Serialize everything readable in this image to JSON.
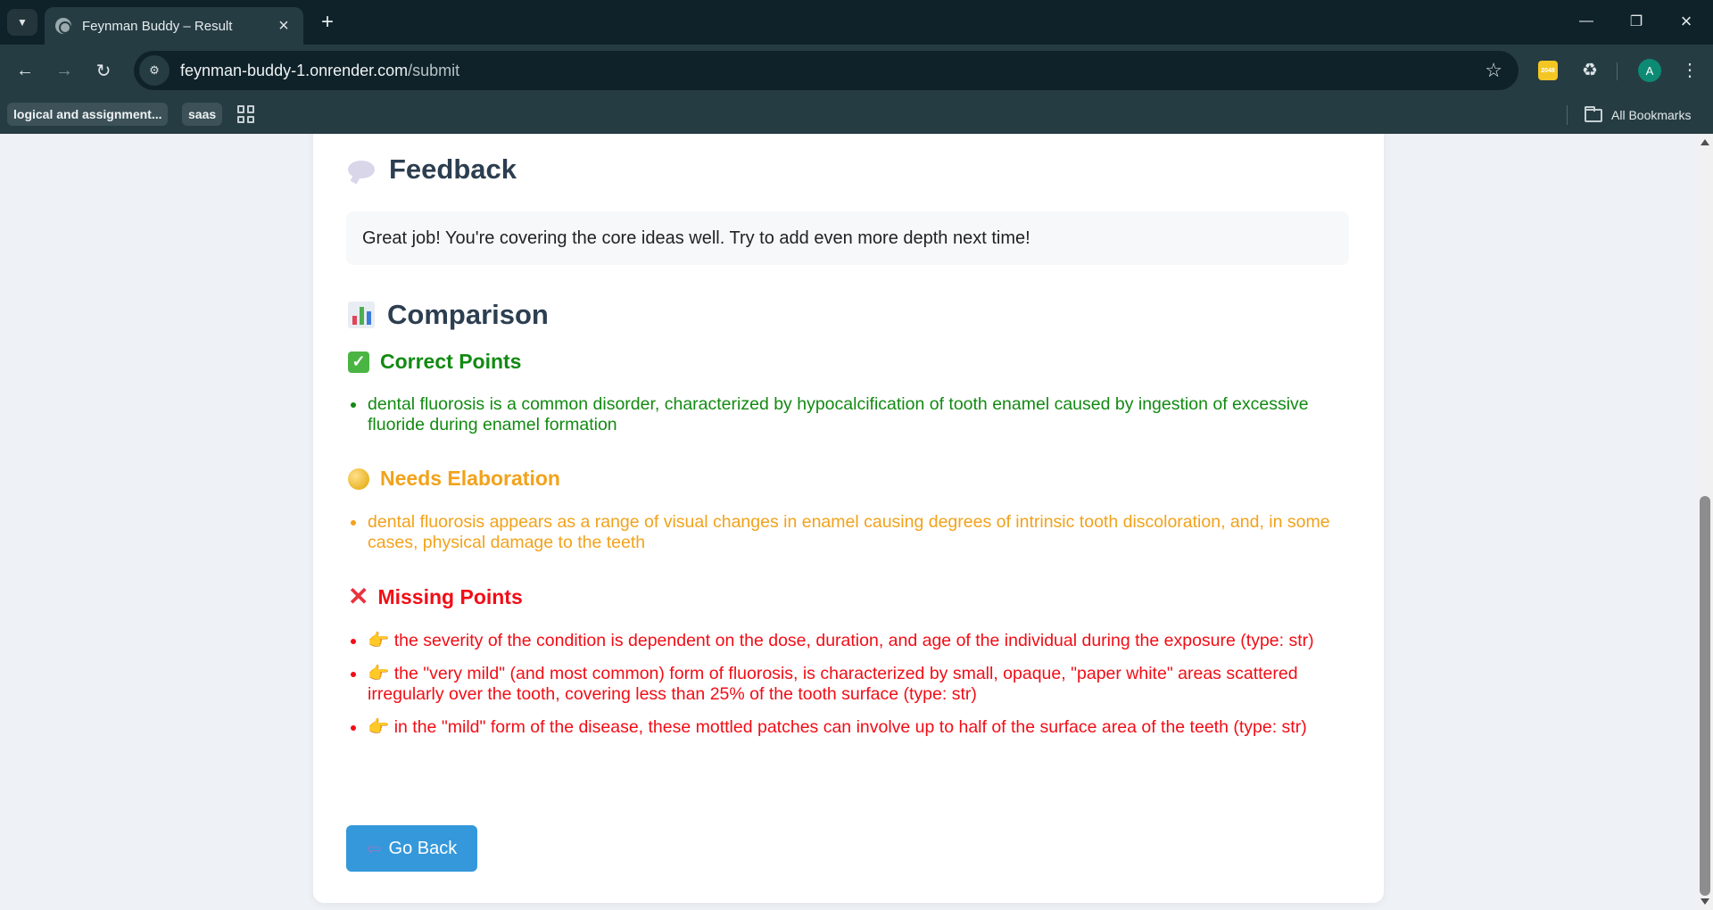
{
  "browser": {
    "tab_title": "Feynman Buddy – Result",
    "url_host": "feynman-buddy-1.onrender.com",
    "url_path": "/submit",
    "profile_initial": "A",
    "extension_badge": "2048",
    "bookmarks": [
      "logical and assignment...",
      "saas"
    ],
    "all_bookmarks_label": "All Bookmarks"
  },
  "page": {
    "feedback": {
      "title": "Feedback",
      "text": "Great job! You're covering the core ideas well. Try to add even more depth next time!"
    },
    "comparison": {
      "title": "Comparison",
      "correct": {
        "title": "Correct Points",
        "color": "#128a12",
        "items": [
          "dental fluorosis is a common disorder, characterized by hypocalcification of tooth enamel caused by ingestion of excessive fluoride during enamel formation"
        ]
      },
      "elaboration": {
        "title": "Needs Elaboration",
        "color": "#f2a21b",
        "items": [
          "dental fluorosis appears as a range of visual changes in enamel causing degrees of intrinsic tooth discoloration, and, in some cases, physical damage to the teeth"
        ]
      },
      "missing": {
        "title": "Missing Points",
        "color": "#f20d16",
        "items": [
          "the severity of the condition is dependent on the dose, duration, and age of the individual during the exposure (type: str)",
          "the \"very mild\" (and most common) form of fluorosis, is characterized by small, opaque, \"paper white\" areas scattered irregularly over the tooth, covering less than 25% of the tooth surface (type: str)",
          "in the \"mild\" form of the disease, these mottled patches can involve up to half of the surface area of the teeth (type: str)"
        ]
      }
    },
    "go_back_label": "Go Back"
  }
}
